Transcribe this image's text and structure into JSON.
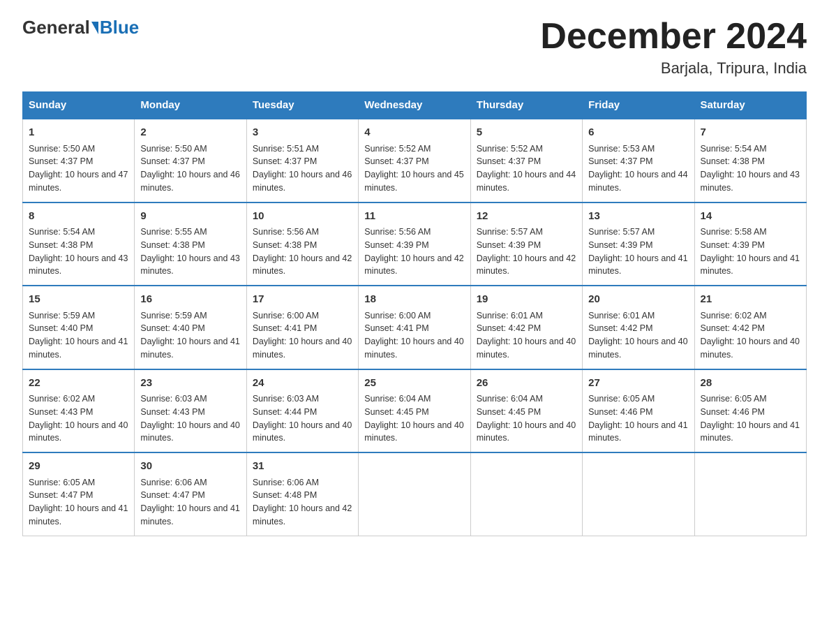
{
  "header": {
    "logo_general": "General",
    "logo_blue": "Blue",
    "title": "December 2024",
    "subtitle": "Barjala, Tripura, India"
  },
  "columns": [
    "Sunday",
    "Monday",
    "Tuesday",
    "Wednesday",
    "Thursday",
    "Friday",
    "Saturday"
  ],
  "weeks": [
    [
      {
        "day": "1",
        "sunrise": "Sunrise: 5:50 AM",
        "sunset": "Sunset: 4:37 PM",
        "daylight": "Daylight: 10 hours and 47 minutes."
      },
      {
        "day": "2",
        "sunrise": "Sunrise: 5:50 AM",
        "sunset": "Sunset: 4:37 PM",
        "daylight": "Daylight: 10 hours and 46 minutes."
      },
      {
        "day": "3",
        "sunrise": "Sunrise: 5:51 AM",
        "sunset": "Sunset: 4:37 PM",
        "daylight": "Daylight: 10 hours and 46 minutes."
      },
      {
        "day": "4",
        "sunrise": "Sunrise: 5:52 AM",
        "sunset": "Sunset: 4:37 PM",
        "daylight": "Daylight: 10 hours and 45 minutes."
      },
      {
        "day": "5",
        "sunrise": "Sunrise: 5:52 AM",
        "sunset": "Sunset: 4:37 PM",
        "daylight": "Daylight: 10 hours and 44 minutes."
      },
      {
        "day": "6",
        "sunrise": "Sunrise: 5:53 AM",
        "sunset": "Sunset: 4:37 PM",
        "daylight": "Daylight: 10 hours and 44 minutes."
      },
      {
        "day": "7",
        "sunrise": "Sunrise: 5:54 AM",
        "sunset": "Sunset: 4:38 PM",
        "daylight": "Daylight: 10 hours and 43 minutes."
      }
    ],
    [
      {
        "day": "8",
        "sunrise": "Sunrise: 5:54 AM",
        "sunset": "Sunset: 4:38 PM",
        "daylight": "Daylight: 10 hours and 43 minutes."
      },
      {
        "day": "9",
        "sunrise": "Sunrise: 5:55 AM",
        "sunset": "Sunset: 4:38 PM",
        "daylight": "Daylight: 10 hours and 43 minutes."
      },
      {
        "day": "10",
        "sunrise": "Sunrise: 5:56 AM",
        "sunset": "Sunset: 4:38 PM",
        "daylight": "Daylight: 10 hours and 42 minutes."
      },
      {
        "day": "11",
        "sunrise": "Sunrise: 5:56 AM",
        "sunset": "Sunset: 4:39 PM",
        "daylight": "Daylight: 10 hours and 42 minutes."
      },
      {
        "day": "12",
        "sunrise": "Sunrise: 5:57 AM",
        "sunset": "Sunset: 4:39 PM",
        "daylight": "Daylight: 10 hours and 42 minutes."
      },
      {
        "day": "13",
        "sunrise": "Sunrise: 5:57 AM",
        "sunset": "Sunset: 4:39 PM",
        "daylight": "Daylight: 10 hours and 41 minutes."
      },
      {
        "day": "14",
        "sunrise": "Sunrise: 5:58 AM",
        "sunset": "Sunset: 4:39 PM",
        "daylight": "Daylight: 10 hours and 41 minutes."
      }
    ],
    [
      {
        "day": "15",
        "sunrise": "Sunrise: 5:59 AM",
        "sunset": "Sunset: 4:40 PM",
        "daylight": "Daylight: 10 hours and 41 minutes."
      },
      {
        "day": "16",
        "sunrise": "Sunrise: 5:59 AM",
        "sunset": "Sunset: 4:40 PM",
        "daylight": "Daylight: 10 hours and 41 minutes."
      },
      {
        "day": "17",
        "sunrise": "Sunrise: 6:00 AM",
        "sunset": "Sunset: 4:41 PM",
        "daylight": "Daylight: 10 hours and 40 minutes."
      },
      {
        "day": "18",
        "sunrise": "Sunrise: 6:00 AM",
        "sunset": "Sunset: 4:41 PM",
        "daylight": "Daylight: 10 hours and 40 minutes."
      },
      {
        "day": "19",
        "sunrise": "Sunrise: 6:01 AM",
        "sunset": "Sunset: 4:42 PM",
        "daylight": "Daylight: 10 hours and 40 minutes."
      },
      {
        "day": "20",
        "sunrise": "Sunrise: 6:01 AM",
        "sunset": "Sunset: 4:42 PM",
        "daylight": "Daylight: 10 hours and 40 minutes."
      },
      {
        "day": "21",
        "sunrise": "Sunrise: 6:02 AM",
        "sunset": "Sunset: 4:42 PM",
        "daylight": "Daylight: 10 hours and 40 minutes."
      }
    ],
    [
      {
        "day": "22",
        "sunrise": "Sunrise: 6:02 AM",
        "sunset": "Sunset: 4:43 PM",
        "daylight": "Daylight: 10 hours and 40 minutes."
      },
      {
        "day": "23",
        "sunrise": "Sunrise: 6:03 AM",
        "sunset": "Sunset: 4:43 PM",
        "daylight": "Daylight: 10 hours and 40 minutes."
      },
      {
        "day": "24",
        "sunrise": "Sunrise: 6:03 AM",
        "sunset": "Sunset: 4:44 PM",
        "daylight": "Daylight: 10 hours and 40 minutes."
      },
      {
        "day": "25",
        "sunrise": "Sunrise: 6:04 AM",
        "sunset": "Sunset: 4:45 PM",
        "daylight": "Daylight: 10 hours and 40 minutes."
      },
      {
        "day": "26",
        "sunrise": "Sunrise: 6:04 AM",
        "sunset": "Sunset: 4:45 PM",
        "daylight": "Daylight: 10 hours and 40 minutes."
      },
      {
        "day": "27",
        "sunrise": "Sunrise: 6:05 AM",
        "sunset": "Sunset: 4:46 PM",
        "daylight": "Daylight: 10 hours and 41 minutes."
      },
      {
        "day": "28",
        "sunrise": "Sunrise: 6:05 AM",
        "sunset": "Sunset: 4:46 PM",
        "daylight": "Daylight: 10 hours and 41 minutes."
      }
    ],
    [
      {
        "day": "29",
        "sunrise": "Sunrise: 6:05 AM",
        "sunset": "Sunset: 4:47 PM",
        "daylight": "Daylight: 10 hours and 41 minutes."
      },
      {
        "day": "30",
        "sunrise": "Sunrise: 6:06 AM",
        "sunset": "Sunset: 4:47 PM",
        "daylight": "Daylight: 10 hours and 41 minutes."
      },
      {
        "day": "31",
        "sunrise": "Sunrise: 6:06 AM",
        "sunset": "Sunset: 4:48 PM",
        "daylight": "Daylight: 10 hours and 42 minutes."
      },
      null,
      null,
      null,
      null
    ]
  ]
}
